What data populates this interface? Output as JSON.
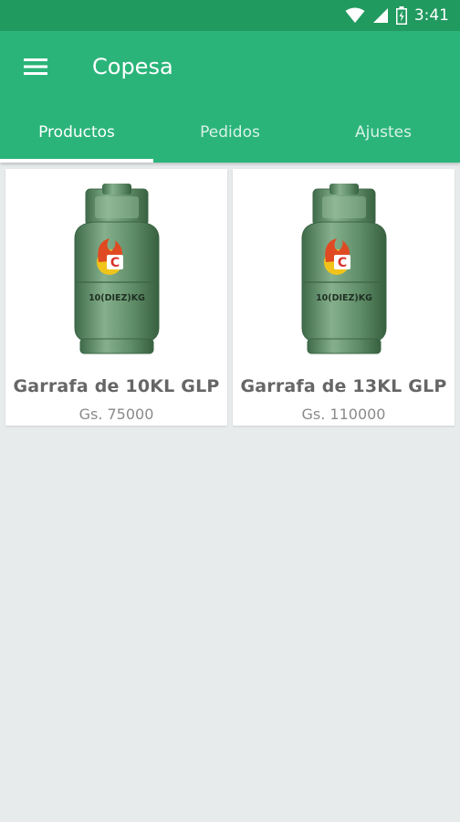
{
  "status_bar": {
    "time": "3:41",
    "icons": [
      "wifi-icon",
      "signal-icon",
      "battery-icon"
    ]
  },
  "app_bar": {
    "title": "Copesa",
    "menu_icon": "hamburger-menu-icon"
  },
  "tabs": [
    {
      "label": "Productos",
      "active": true
    },
    {
      "label": "Pedidos",
      "active": false
    },
    {
      "label": "Ajustes",
      "active": false
    }
  ],
  "products": [
    {
      "name": "Garrafa de 10KL GLP",
      "price": "Gs. 75000",
      "tank_label": "10(DIEZ)KG"
    },
    {
      "name": "Garrafa de 13KL GLP",
      "price": "Gs. 110000",
      "tank_label": "10(DIEZ)KG"
    }
  ],
  "colors": {
    "primary": "#2bb47a",
    "primary_dark": "#219a5f",
    "background": "#e8ebec"
  }
}
